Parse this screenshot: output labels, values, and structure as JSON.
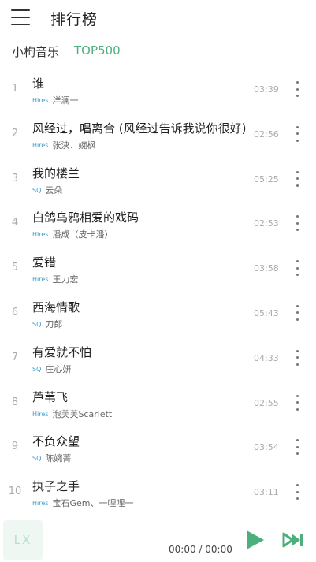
{
  "header": {
    "title": "排行榜",
    "menu_icon": "menu-icon"
  },
  "tabs": {
    "source": "小枸音乐",
    "active_list": "TOP500",
    "active_color": "#4daf7c"
  },
  "songs": [
    {
      "num": "1",
      "title": "谁",
      "quality": "Hires",
      "artist": "洋澜一",
      "duration": "03:39"
    },
    {
      "num": "2",
      "title": "风经过，唱离合 (风经过告诉我说你很好)",
      "quality": "Hires",
      "artist": "张浹、婉枫",
      "duration": "02:56"
    },
    {
      "num": "3",
      "title": "我的楼兰",
      "quality": "SQ",
      "artist": "云朵",
      "duration": "05:25"
    },
    {
      "num": "4",
      "title": "白鸽乌鸦相爱的戏码",
      "quality": "Hires",
      "artist": "潘成（皮卡潘）",
      "duration": "02:53"
    },
    {
      "num": "5",
      "title": "爱错",
      "quality": "Hires",
      "artist": "王力宏",
      "duration": "03:58"
    },
    {
      "num": "6",
      "title": "西海情歌",
      "quality": "SQ",
      "artist": "刀郎",
      "duration": "05:43"
    },
    {
      "num": "7",
      "title": "有爱就不怕",
      "quality": "SQ",
      "artist": "庄心妍",
      "duration": "04:33"
    },
    {
      "num": "8",
      "title": "芦苇飞",
      "quality": "Hires",
      "artist": "泡芙芙Scarlett",
      "duration": "02:55"
    },
    {
      "num": "9",
      "title": "不负众望",
      "quality": "SQ",
      "artist": "陈婉菁",
      "duration": "03:54"
    },
    {
      "num": "10",
      "title": "执子之手",
      "quality": "Hires",
      "artist": "宝石Gem、一哩哩一",
      "duration": "03:11"
    }
  ],
  "player": {
    "cover_text": "LX",
    "time": "00:00 / 00:00",
    "accent": "#4daf7c"
  }
}
